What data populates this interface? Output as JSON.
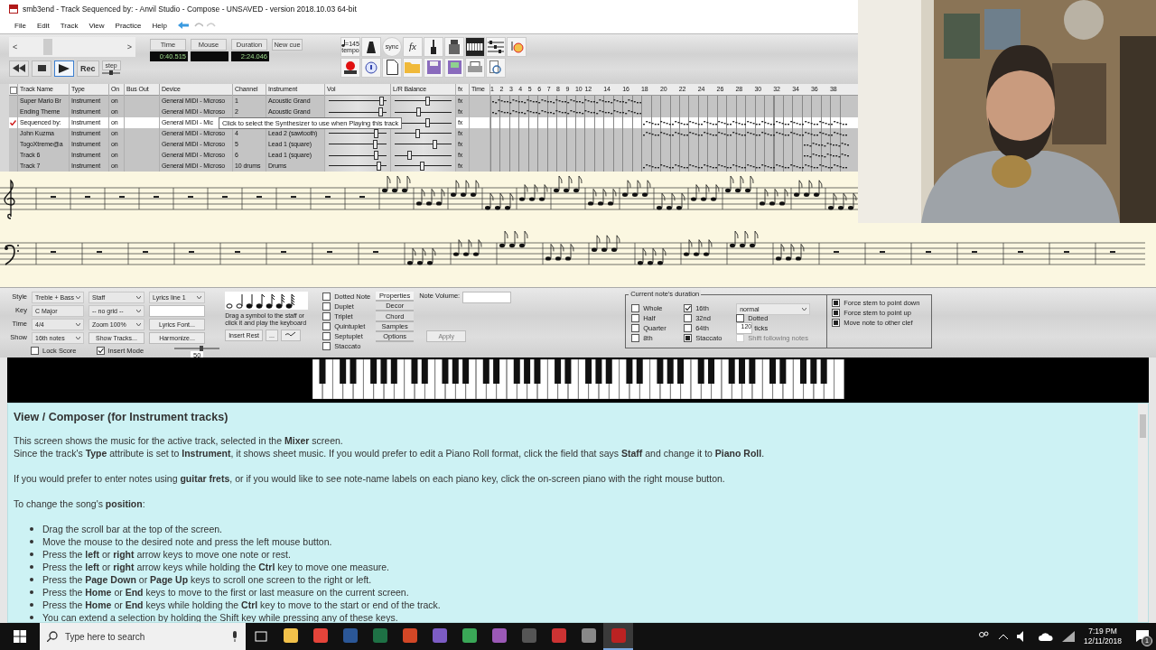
{
  "window": {
    "title": "smb3end - Track Sequenced by: - Anvil Studio - Compose - UNSAVED - version 2018.10.03 64-bit"
  },
  "menu": [
    "File",
    "Edit",
    "Track",
    "View",
    "Practice",
    "Help"
  ],
  "scroller": {
    "left": "<",
    "right": ">"
  },
  "transport": [
    {
      "kind": "rewind",
      "selected": false
    },
    {
      "kind": "stop",
      "selected": false
    },
    {
      "kind": "play",
      "selected": true
    },
    {
      "kind": "record",
      "label": "Rec",
      "selected": false
    }
  ],
  "step": {
    "label": "step"
  },
  "displays": [
    {
      "label": "Time",
      "value": "0:40.515"
    },
    {
      "label": "Mouse"
    },
    {
      "label": "Duration",
      "value": "2:24.046"
    }
  ],
  "new_cue": "New cue",
  "tools": {
    "tempo_value": "=145",
    "tempo_label": "tempo",
    "sync_label": "sync",
    "fx_label": "fx"
  },
  "tracks": {
    "all_checked": false,
    "columns": [
      "Track Name",
      "Type",
      "On",
      "Bus Out",
      "Device",
      "Channel",
      "Instrument",
      "Vol",
      "L/R Balance",
      "fx",
      "Time"
    ],
    "measures": [
      "1",
      "2",
      "3",
      "4",
      "5",
      "6",
      "7",
      "8",
      "9",
      "10",
      "12",
      "14",
      "16",
      "18",
      "20",
      "22",
      "24",
      "26",
      "28",
      "30",
      "32",
      "34",
      "36",
      "38"
    ],
    "rows": [
      {
        "checked": false,
        "selected": false,
        "name": "Super Mario Br",
        "type": "Instrument",
        "on": "on",
        "device": "General MIDI - Microso",
        "channel": "1",
        "instrument": "Acoustic Grand",
        "vol": {
          "level": 0.92
        },
        "balance": {
          "level": 0.58
        },
        "fx": "fx"
      },
      {
        "checked": false,
        "selected": false,
        "name": "Ending Theme",
        "type": "Instrument",
        "on": "on",
        "device": "General MIDI - Microso",
        "channel": "2",
        "instrument": "Acoustic Grand",
        "vol": {
          "level": 0.9
        },
        "balance": {
          "level": 0.43
        },
        "fx": "fx"
      },
      {
        "checked": true,
        "selected": true,
        "name": "Sequenced by:",
        "type": "Instrument",
        "on": "on",
        "device": "General MIDI - Mic",
        "balance": {
          "level": 0.58
        },
        "fx": "fx"
      },
      {
        "checked": false,
        "selected": false,
        "name": "John Kuzma",
        "type": "Instrument",
        "on": "on",
        "device": "General MIDI - Microso",
        "channel": "4",
        "instrument": "Lead 2 (sawtooth)",
        "vol": {
          "level": 0.83
        },
        "balance": {
          "level": 0.41
        },
        "fx": "fx"
      },
      {
        "checked": false,
        "selected": false,
        "name": "TogoXtreme@a",
        "type": "Instrument",
        "on": "on",
        "device": "General MIDI - Microso",
        "channel": "5",
        "instrument": "Lead 1 (square)",
        "vol": {
          "level": 0.82
        },
        "balance": {
          "level": 0.71
        },
        "fx": "fx"
      },
      {
        "checked": false,
        "selected": false,
        "name": "Track 6",
        "type": "Instrument",
        "on": "on",
        "device": "General MIDI - Microso",
        "channel": "6",
        "instrument": "Lead 1 (square)",
        "vol": {
          "level": 0.83
        },
        "balance": {
          "level": 0.27
        },
        "fx": "fx"
      },
      {
        "checked": false,
        "selected": false,
        "name": "Track 7",
        "type": "Instrument",
        "on": "on",
        "device": "General MIDI - Microso",
        "channel": "10 drums",
        "instrument": "Drums",
        "vol": {
          "level": 0.87
        },
        "balance": {
          "level": 0.49
        },
        "fx": "fx"
      }
    ]
  },
  "tooltip": "Click to select the Synthesizer to use when Playing this track",
  "score_options": {
    "rows": [
      {
        "label": "Style",
        "fields": [
          {
            "kind": "select",
            "value": "Treble + Bass"
          },
          {
            "kind": "select",
            "value": "Staff"
          },
          {
            "kind": "select",
            "value": "Lyrics line 1"
          }
        ]
      },
      {
        "label": "Key",
        "fields": [
          {
            "kind": "text",
            "value": "C Major"
          },
          {
            "kind": "select",
            "value": "-- no grid --"
          },
          {
            "kind": "input"
          }
        ]
      },
      {
        "label": "Time",
        "fields": [
          {
            "kind": "select",
            "value": "4/4"
          },
          {
            "kind": "select",
            "value": "Zoom 100%"
          },
          {
            "kind": "button",
            "value": "Lyrics Font..."
          }
        ]
      },
      {
        "label": "Show",
        "fields": [
          {
            "kind": "select",
            "value": "16th notes"
          },
          {
            "kind": "button",
            "value": "Show Tracks..."
          },
          {
            "kind": "button",
            "value": "Harmonize..."
          }
        ]
      }
    ],
    "checks": [
      {
        "label": "Lock Score",
        "checked": false
      },
      {
        "label": "Insert Mode",
        "checked": true
      }
    ],
    "slider": {
      "level": 0.6,
      "reading": "50"
    }
  },
  "palette": {
    "hint": "Drag a symbol to the staff or click it and play the keyboard",
    "buttons": [
      "Insert Rest",
      "..."
    ]
  },
  "modifiers": [
    {
      "label": "Dotted Note",
      "checked": false
    },
    {
      "label": "Duplet",
      "checked": false
    },
    {
      "label": "Triplet",
      "checked": false
    },
    {
      "label": "Quintuplet",
      "checked": false
    },
    {
      "label": "Septuplet",
      "checked": false
    },
    {
      "label": "Staccato",
      "checked": false
    }
  ],
  "tabs": [
    {
      "label": "Properties",
      "selected": true
    },
    {
      "label": "Decor",
      "selected": false
    },
    {
      "label": "Chord",
      "selected": false
    },
    {
      "label": "Samples",
      "selected": false
    },
    {
      "label": "Options",
      "selected": false
    }
  ],
  "note_volume": {
    "label": "Note Volume:",
    "apply": "Apply"
  },
  "duration": {
    "title": "Current note's duration",
    "options": [
      {
        "label": "Whole",
        "checked": false,
        "indeterminate": false
      },
      {
        "label": "Half",
        "checked": false,
        "indeterminate": false
      },
      {
        "label": "Quarter",
        "checked": false,
        "indeterminate": false
      },
      {
        "label": "8th",
        "checked": false,
        "indeterminate": false
      },
      {
        "label": "16th",
        "checked": true,
        "indeterminate": false
      },
      {
        "label": "32nd",
        "checked": false,
        "indeterminate": false
      },
      {
        "label": "64th",
        "checked": false,
        "indeterminate": false
      },
      {
        "label": "Staccato",
        "checked": false,
        "indeterminate": true
      }
    ],
    "mode": "normal",
    "dotted": {
      "label": "Dotted",
      "checked": false
    },
    "ticks": {
      "value": "120",
      "label": "ticks"
    },
    "shift": {
      "label": "Shift following notes",
      "disabled": true
    }
  },
  "stem_options": [
    {
      "label": "Force stem to point down",
      "indeterminate": true
    },
    {
      "label": "Force stem to point up",
      "indeterminate": true
    },
    {
      "label": "Move note to other clef",
      "indeterminate": true
    }
  ],
  "help": {
    "title": "View / Composer (for Instrument tracks)",
    "blocks": [
      {
        "kind": "paragraph",
        "lines": [
          "This screen shows the music for the active track, selected in the **Mixer** screen.",
          "Since the track's **Type** attribute is set to **Instrument**, it shows sheet music. If you would prefer to edit a Piano Roll format, click the field that says **Staff** and change it to **Piano Roll**."
        ]
      },
      {
        "kind": "paragraph",
        "lines": [
          "If you would prefer to enter notes using **guitar frets**, or if you would like to see note-name labels on each piano key, click the on-screen piano with the right mouse button."
        ]
      },
      {
        "kind": "paragraph",
        "lines": [
          "To change the song's **position**:"
        ]
      },
      {
        "kind": "list",
        "lines": [
          "Drag the scroll bar at the top of the screen.",
          "Move the mouse to the desired note and press the left mouse button.",
          "Press the **left** or **right** arrow keys to move one note or rest.",
          "Press the **left** or **right** arrow keys while holding the **Ctrl** key to move one measure.",
          "Press the **Page Down** or **Page Up** keys to scroll one screen to the right or left.",
          "Press the **Home** or **End** keys to move to the first or last measure on the current screen.",
          "Press the **Home** or **End** keys while holding the **Ctrl** key to move to the start or end of the track.",
          "You can extend a selection by holding the Shift key while pressing any of these keys."
        ]
      }
    ]
  },
  "taskbar": {
    "search": {
      "placeholder": "Type here to search"
    },
    "apps": [
      {
        "selected": false
      },
      {
        "selected": false
      },
      {
        "selected": false
      },
      {
        "selected": false
      },
      {
        "selected": false
      },
      {
        "selected": false
      },
      {
        "selected": false
      },
      {
        "selected": false
      },
      {
        "selected": false
      },
      {
        "selected": false
      },
      {
        "selected": false
      },
      {
        "selected": true
      }
    ],
    "time": "7:19 PM",
    "date": "12/11/2018",
    "notifications": "1"
  }
}
